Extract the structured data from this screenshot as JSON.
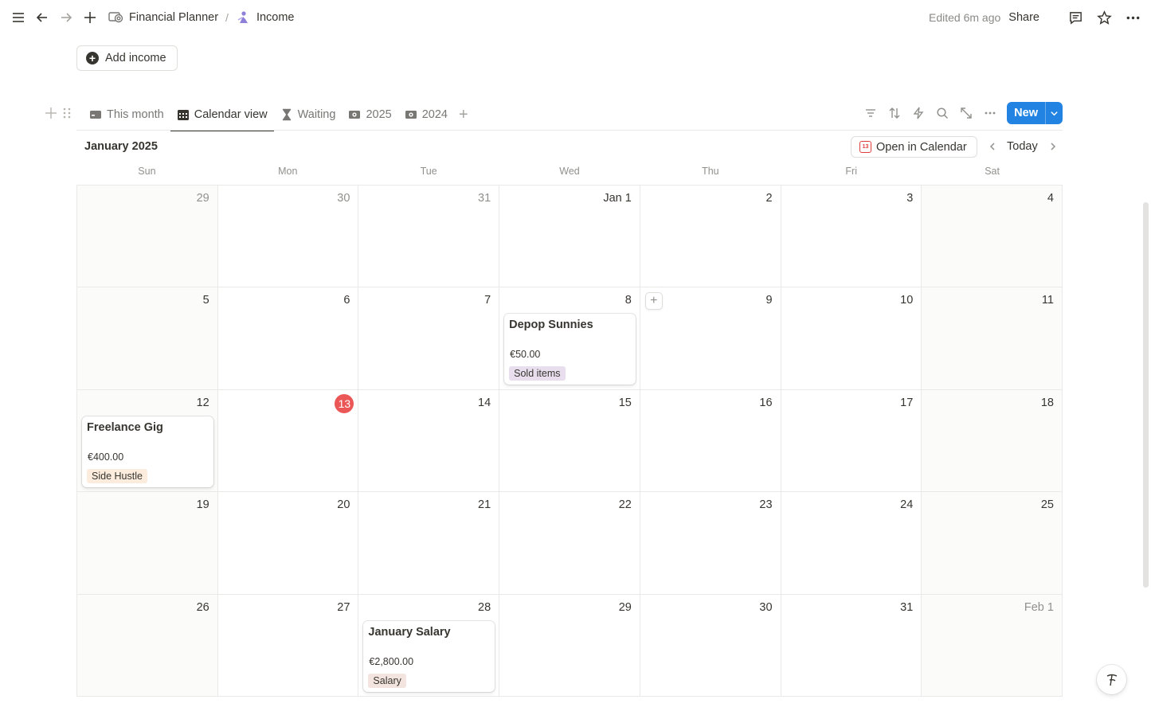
{
  "topbar": {
    "breadcrumb": [
      {
        "label": "Financial Planner",
        "icon": "money-icon"
      },
      {
        "label": "Income",
        "icon": "income-icon"
      }
    ],
    "separator": "/",
    "edited": "Edited 6m ago",
    "share_label": "Share"
  },
  "add_income_label": "Add income",
  "views": {
    "tabs": [
      {
        "label": "This month",
        "icon": "card-icon",
        "active": false
      },
      {
        "label": "Calendar view",
        "icon": "calendar-icon",
        "active": true
      },
      {
        "label": "Waiting",
        "icon": "hourglass-icon",
        "active": false
      },
      {
        "label": "2025",
        "icon": "banknote-icon",
        "active": false
      },
      {
        "label": "2024",
        "icon": "banknote-icon",
        "active": false
      }
    ],
    "new_label": "New"
  },
  "calendar": {
    "month_title": "January 2025",
    "open_in_calendar": "Open in Calendar",
    "today_label": "Today",
    "weekdays": [
      "Sun",
      "Mon",
      "Tue",
      "Wed",
      "Thu",
      "Fri",
      "Sat"
    ],
    "days": [
      {
        "label": "29",
        "muted": true
      },
      {
        "label": "30",
        "muted": true
      },
      {
        "label": "31",
        "muted": true
      },
      {
        "label": "Jan 1"
      },
      {
        "label": "2"
      },
      {
        "label": "3"
      },
      {
        "label": "4"
      },
      {
        "label": "5"
      },
      {
        "label": "6"
      },
      {
        "label": "7"
      },
      {
        "label": "8"
      },
      {
        "label": "9"
      },
      {
        "label": "10"
      },
      {
        "label": "11"
      },
      {
        "label": "12"
      },
      {
        "label": "13",
        "today": true
      },
      {
        "label": "14"
      },
      {
        "label": "15"
      },
      {
        "label": "16"
      },
      {
        "label": "17"
      },
      {
        "label": "18"
      },
      {
        "label": "19"
      },
      {
        "label": "20"
      },
      {
        "label": "21"
      },
      {
        "label": "22"
      },
      {
        "label": "23"
      },
      {
        "label": "24"
      },
      {
        "label": "25"
      },
      {
        "label": "26"
      },
      {
        "label": "27"
      },
      {
        "label": "28"
      },
      {
        "label": "29"
      },
      {
        "label": "30"
      },
      {
        "label": "31"
      },
      {
        "label": "Feb 1",
        "muted": true
      }
    ],
    "events": [
      {
        "cell": 10,
        "title": "Depop Sunnies",
        "amount": "€50.00",
        "tag": "Sold items",
        "tag_color": "#e8deee"
      },
      {
        "cell": 14,
        "title": "Freelance Gig",
        "amount": "€400.00",
        "tag": "Side Hustle",
        "tag_color": "#fbecdd"
      },
      {
        "cell": 30,
        "title": "January Salary",
        "amount": "€2,800.00",
        "tag": "Salary",
        "tag_color": "#f4e4df"
      }
    ],
    "hover_add_cell": 11
  },
  "colors": {
    "accent": "#2383e2",
    "today_badge": "#eb5757"
  }
}
